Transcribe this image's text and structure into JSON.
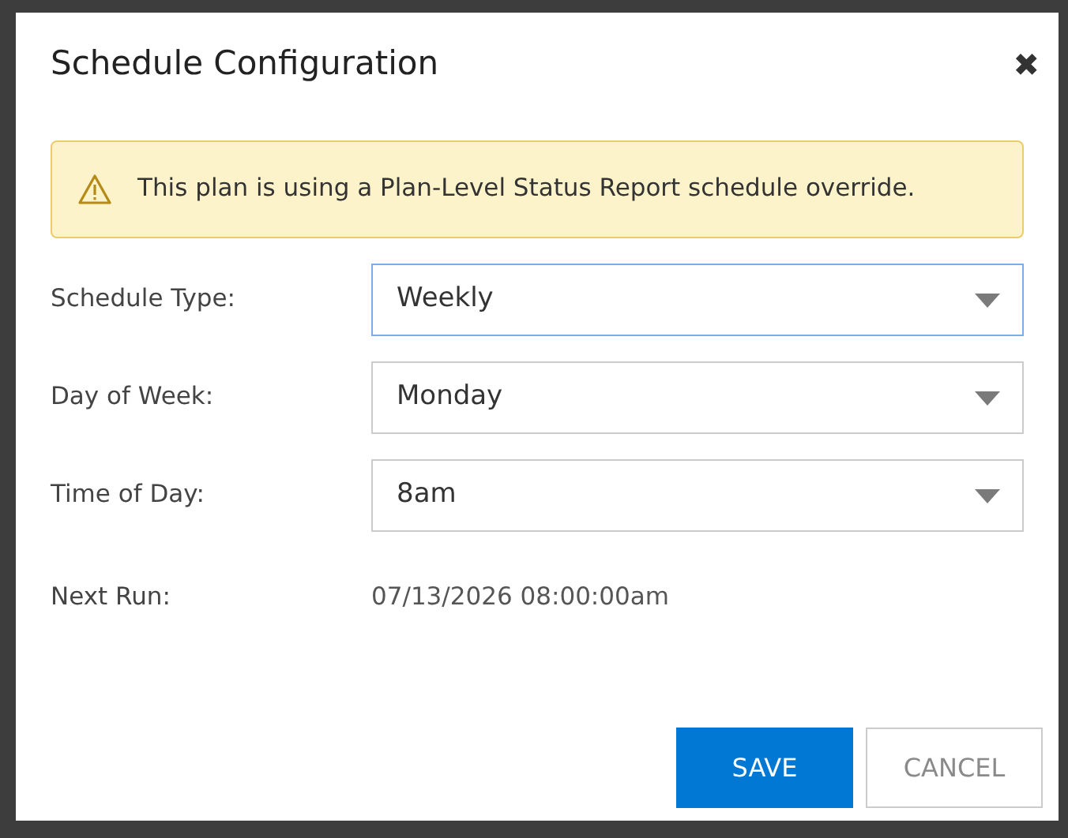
{
  "dialog": {
    "title": "Schedule Configuration",
    "close": "✖"
  },
  "alert": {
    "text": "This plan is using a Plan-Level Status Report schedule override."
  },
  "fields": [
    {
      "label": "Schedule Type:",
      "value": "Weekly",
      "focused": true
    },
    {
      "label": "Day of Week:",
      "value": "Monday",
      "focused": false
    },
    {
      "label": "Time of Day:",
      "value": "8am",
      "focused": false
    }
  ],
  "next_run": {
    "label": "Next Run:",
    "value": "07/13/2026 08:00:00am"
  },
  "buttons": [
    {
      "label": "SAVE",
      "kind": "primary"
    },
    {
      "label": "CANCEL",
      "kind": "secondary"
    }
  ]
}
